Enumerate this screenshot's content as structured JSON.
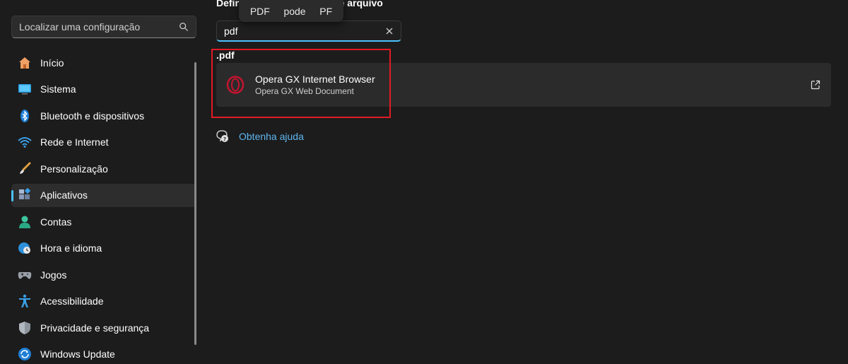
{
  "sidebar": {
    "search_placeholder": "Localizar uma configuração",
    "items": [
      {
        "label": "Início",
        "icon": "home-icon"
      },
      {
        "label": "Sistema",
        "icon": "monitor-icon"
      },
      {
        "label": "Bluetooth e dispositivos",
        "icon": "bluetooth-icon"
      },
      {
        "label": "Rede e Internet",
        "icon": "wifi-icon"
      },
      {
        "label": "Personalização",
        "icon": "brush-icon"
      },
      {
        "label": "Aplicativos",
        "icon": "apps-icon",
        "selected": true
      },
      {
        "label": "Contas",
        "icon": "person-icon"
      },
      {
        "label": "Hora e idioma",
        "icon": "globe-clock-icon"
      },
      {
        "label": "Jogos",
        "icon": "gamepad-icon"
      },
      {
        "label": "Acessibilidade",
        "icon": "accessibility-icon"
      },
      {
        "label": "Privacidade e segurança",
        "icon": "shield-icon"
      },
      {
        "label": "Windows Update",
        "icon": "update-icon"
      }
    ]
  },
  "main": {
    "heading_visible_start": "Defin",
    "heading_visible_end": "de arquivo",
    "suggestions": [
      "PDF",
      "pode",
      "PF"
    ],
    "filter_value": "pdf",
    "extension": ".pdf",
    "app": {
      "name": "Opera GX Internet Browser",
      "description": "Opera GX Web Document",
      "icon": "opera-gx-icon"
    },
    "help_link": "Obtenha ajuda"
  },
  "colors": {
    "accent": "#4cc2ff",
    "highlight": "#e11b24",
    "link": "#5fb6f0",
    "opera": "#c4142f"
  }
}
